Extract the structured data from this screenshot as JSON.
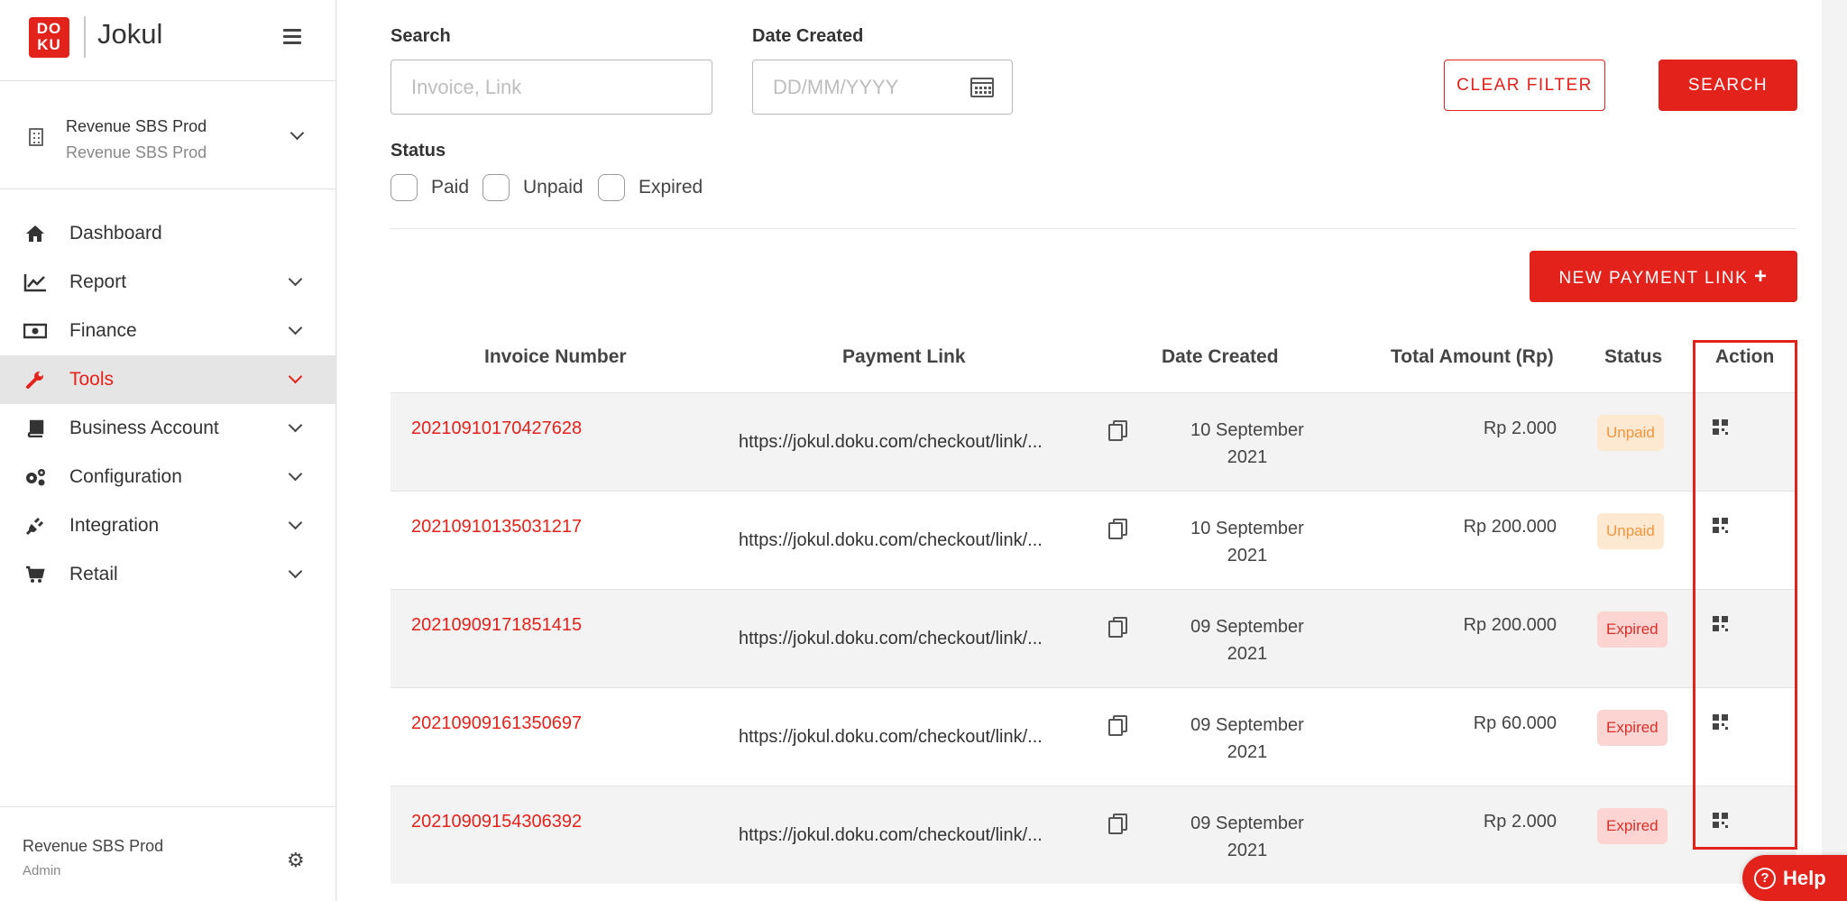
{
  "brand": {
    "logo_text": "DOKU",
    "name": "Jokul"
  },
  "account": {
    "title": "Revenue SBS Prod",
    "subtitle": "Revenue SBS Prod"
  },
  "sidebar": {
    "items": [
      {
        "label": "Dashboard",
        "icon": "home-icon"
      },
      {
        "label": "Report",
        "icon": "chart-line-icon"
      },
      {
        "label": "Finance",
        "icon": "money-icon"
      },
      {
        "label": "Tools",
        "icon": "wrench-icon"
      },
      {
        "label": "Business Account",
        "icon": "book-icon"
      },
      {
        "label": "Configuration",
        "icon": "gears-icon"
      },
      {
        "label": "Integration",
        "icon": "plug-icon"
      },
      {
        "label": "Retail",
        "icon": "cart-icon"
      }
    ],
    "active": "Tools"
  },
  "footer": {
    "name": "Revenue SBS Prod",
    "role": "Admin"
  },
  "filters": {
    "search_label": "Search",
    "search_placeholder": "Invoice, Link",
    "date_label": "Date Created",
    "date_placeholder": "DD/MM/YYYY",
    "status_label": "Status",
    "status_options": [
      "Paid",
      "Unpaid",
      "Expired"
    ],
    "clear_label": "CLEAR FILTER",
    "search_button": "SEARCH"
  },
  "new_link_button": "NEW PAYMENT LINK",
  "table": {
    "headers": [
      "Invoice Number",
      "Payment Link",
      "Date Created",
      "Total Amount (Rp)",
      "Status",
      "Action"
    ],
    "rows": [
      {
        "invoice": "20210910170427628",
        "link": "https://jokul.doku.com/checkout/link/...",
        "date_line1": "10 September",
        "date_line2": "2021",
        "amount": "Rp 2.000",
        "status": "Unpaid"
      },
      {
        "invoice": "20210910135031217",
        "link": "https://jokul.doku.com/checkout/link/...",
        "date_line1": "10 September",
        "date_line2": "2021",
        "amount": "Rp 200.000",
        "status": "Unpaid"
      },
      {
        "invoice": "20210909171851415",
        "link": "https://jokul.doku.com/checkout/link/...",
        "date_line1": "09 September",
        "date_line2": "2021",
        "amount": "Rp 200.000",
        "status": "Expired"
      },
      {
        "invoice": "20210909161350697",
        "link": "https://jokul.doku.com/checkout/link/...",
        "date_line1": "09 September",
        "date_line2": "2021",
        "amount": "Rp 60.000",
        "status": "Expired"
      },
      {
        "invoice": "20210909154306392",
        "link": "https://jokul.doku.com/checkout/link/...",
        "date_line1": "09 September",
        "date_line2": "2021",
        "amount": "Rp 2.000",
        "status": "Expired"
      }
    ]
  },
  "help_label": "Help",
  "colors": {
    "brand_red": "#e3221c",
    "unpaid_bg": "#fde8d2",
    "expired_bg": "#fcd4d2"
  }
}
